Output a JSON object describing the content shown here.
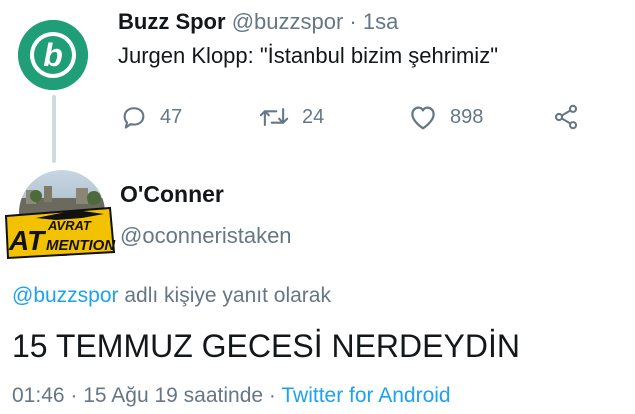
{
  "parent_tweet": {
    "avatar_icon": "buzz-spor-logo-icon",
    "avatar_letter": "b",
    "name": "Buzz Spor",
    "handle": "@buzzspor",
    "separator": "·",
    "time": "1sa",
    "text": "Jurgen Klopp: \"İstanbul bizim şehrimiz\"",
    "actions": {
      "reply": {
        "icon": "reply-icon",
        "count": "47"
      },
      "retweet": {
        "icon": "retweet-icon",
        "count": "24"
      },
      "like": {
        "icon": "heart-icon",
        "count": "898"
      },
      "share": {
        "icon": "share-icon"
      }
    }
  },
  "reply_tweet": {
    "avatar_icon": "avrat-mention-avatar",
    "avatar_text": [
      "AT",
      "AVRAT",
      "MENTION"
    ],
    "name": "O'Conner",
    "handle": "@oconneristaken",
    "replying_to_handle": "@buzzspor",
    "replying_to_suffix": " adlı kişiye yanıt olarak",
    "text": "15 TEMMUZ GECESİ NERDEYDİN",
    "time": "01:46",
    "meta_sep1": " · ",
    "date_text": "15 Ağu 19 saatinde",
    "meta_sep2": " · ",
    "source": "Twitter for Android"
  },
  "colors": {
    "text_primary": "#14171a",
    "text_secondary": "#657786",
    "link_blue": "#1da1f2",
    "buzz_green": "#1f9e78",
    "avatar_yellow": "#f2c200"
  }
}
